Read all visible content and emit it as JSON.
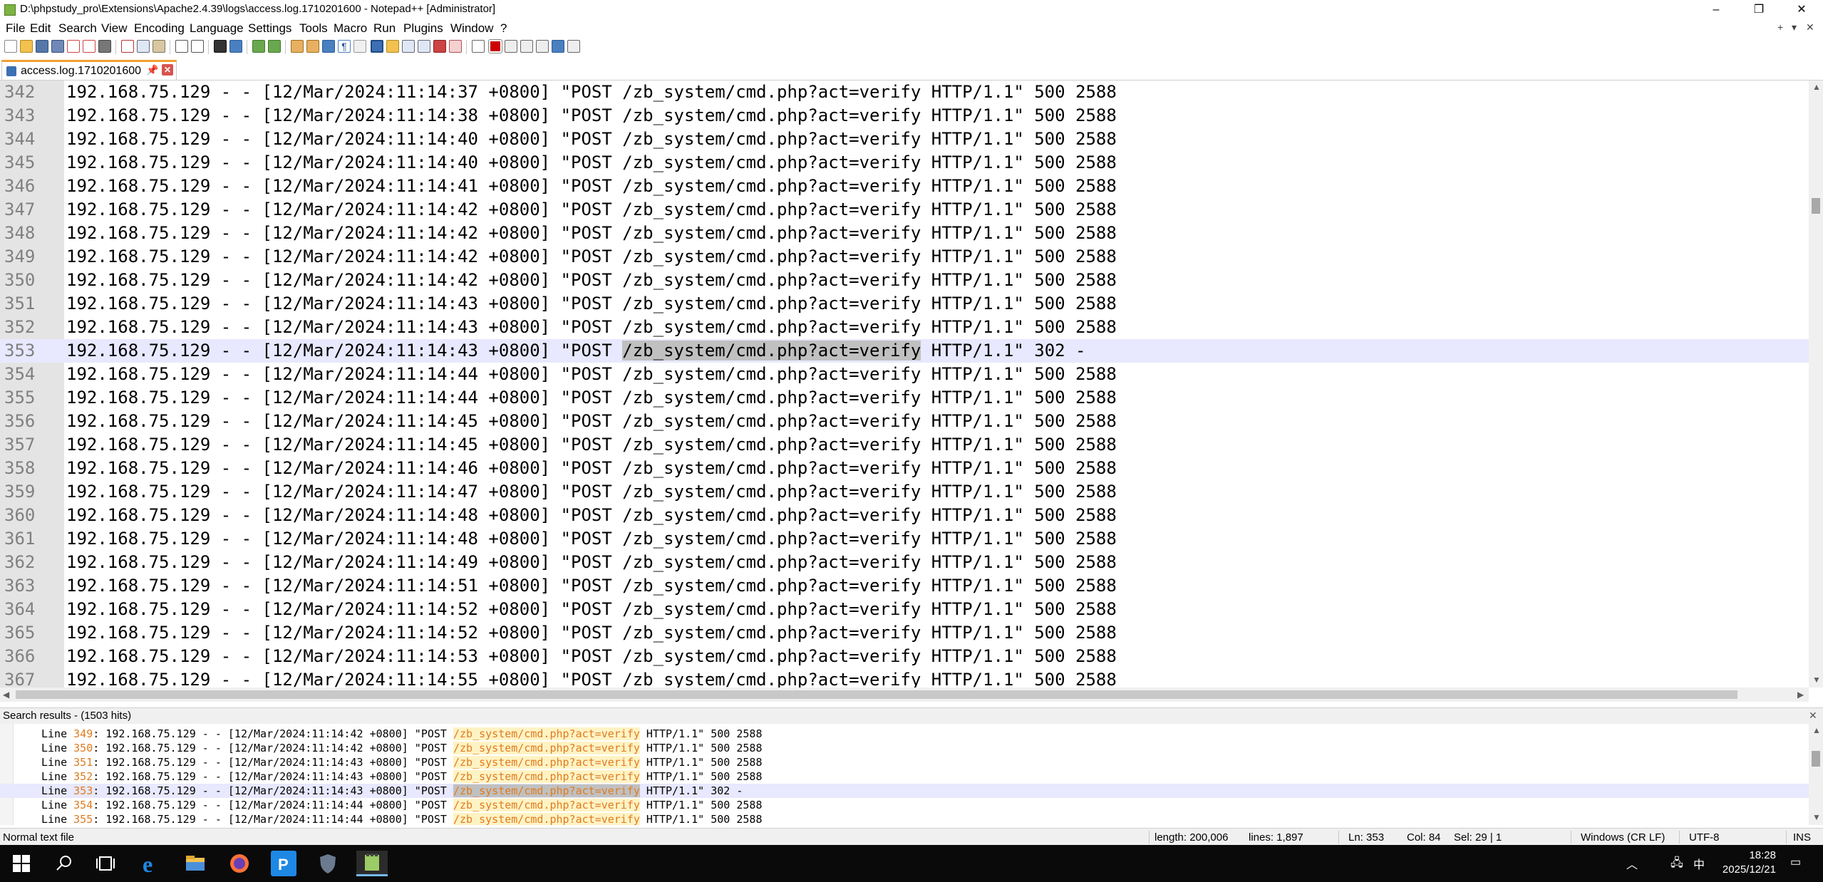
{
  "window": {
    "title": "D:\\phpstudy_pro\\Extensions\\Apache2.4.39\\logs\\access.log.1710201600 - Notepad++ [Administrator]",
    "controls": {
      "minimize": "–",
      "restore": "❐",
      "close": "✕"
    }
  },
  "menu": {
    "items": [
      "File",
      "Edit",
      "Search",
      "View",
      "Encoding",
      "Language",
      "Settings",
      "Tools",
      "Macro",
      "Run",
      "Plugins",
      "Window",
      "?"
    ],
    "right_controls": {
      "add": "+",
      "dropdown": "▾",
      "close": "✕"
    }
  },
  "tab": {
    "label": "access.log.1710201600",
    "pin": "📌",
    "close": "✕"
  },
  "editor": {
    "current_line": "353",
    "selection_text": "/zb_system/cmd.php?act=verify",
    "lines": [
      {
        "num": "342",
        "pre": "192.168.75.129 - - [12/Mar/2024:11:14:37 +0800] \"POST ",
        "sel": "",
        "post": "/zb_system/cmd.php?act=verify HTTP/1.1\" 500 2588"
      },
      {
        "num": "343",
        "pre": "192.168.75.129 - - [12/Mar/2024:11:14:38 +0800] \"POST ",
        "sel": "",
        "post": "/zb_system/cmd.php?act=verify HTTP/1.1\" 500 2588"
      },
      {
        "num": "344",
        "pre": "192.168.75.129 - - [12/Mar/2024:11:14:40 +0800] \"POST ",
        "sel": "",
        "post": "/zb_system/cmd.php?act=verify HTTP/1.1\" 500 2588"
      },
      {
        "num": "345",
        "pre": "192.168.75.129 - - [12/Mar/2024:11:14:40 +0800] \"POST ",
        "sel": "",
        "post": "/zb_system/cmd.php?act=verify HTTP/1.1\" 500 2588"
      },
      {
        "num": "346",
        "pre": "192.168.75.129 - - [12/Mar/2024:11:14:41 +0800] \"POST ",
        "sel": "",
        "post": "/zb_system/cmd.php?act=verify HTTP/1.1\" 500 2588"
      },
      {
        "num": "347",
        "pre": "192.168.75.129 - - [12/Mar/2024:11:14:42 +0800] \"POST ",
        "sel": "",
        "post": "/zb_system/cmd.php?act=verify HTTP/1.1\" 500 2588"
      },
      {
        "num": "348",
        "pre": "192.168.75.129 - - [12/Mar/2024:11:14:42 +0800] \"POST ",
        "sel": "",
        "post": "/zb_system/cmd.php?act=verify HTTP/1.1\" 500 2588"
      },
      {
        "num": "349",
        "pre": "192.168.75.129 - - [12/Mar/2024:11:14:42 +0800] \"POST ",
        "sel": "",
        "post": "/zb_system/cmd.php?act=verify HTTP/1.1\" 500 2588"
      },
      {
        "num": "350",
        "pre": "192.168.75.129 - - [12/Mar/2024:11:14:42 +0800] \"POST ",
        "sel": "",
        "post": "/zb_system/cmd.php?act=verify HTTP/1.1\" 500 2588"
      },
      {
        "num": "351",
        "pre": "192.168.75.129 - - [12/Mar/2024:11:14:43 +0800] \"POST ",
        "sel": "",
        "post": "/zb_system/cmd.php?act=verify HTTP/1.1\" 500 2588"
      },
      {
        "num": "352",
        "pre": "192.168.75.129 - - [12/Mar/2024:11:14:43 +0800] \"POST ",
        "sel": "",
        "post": "/zb_system/cmd.php?act=verify HTTP/1.1\" 500 2588"
      },
      {
        "num": "353",
        "pre": "192.168.75.129 - - [12/Mar/2024:11:14:43 +0800] \"POST ",
        "sel": "/zb_system/cmd.php?act=verify",
        "post": " HTTP/1.1\" 302 -"
      },
      {
        "num": "354",
        "pre": "192.168.75.129 - - [12/Mar/2024:11:14:44 +0800] \"POST ",
        "sel": "",
        "post": "/zb_system/cmd.php?act=verify HTTP/1.1\" 500 2588"
      },
      {
        "num": "355",
        "pre": "192.168.75.129 - - [12/Mar/2024:11:14:44 +0800] \"POST ",
        "sel": "",
        "post": "/zb_system/cmd.php?act=verify HTTP/1.1\" 500 2588"
      },
      {
        "num": "356",
        "pre": "192.168.75.129 - - [12/Mar/2024:11:14:45 +0800] \"POST ",
        "sel": "",
        "post": "/zb_system/cmd.php?act=verify HTTP/1.1\" 500 2588"
      },
      {
        "num": "357",
        "pre": "192.168.75.129 - - [12/Mar/2024:11:14:45 +0800] \"POST ",
        "sel": "",
        "post": "/zb_system/cmd.php?act=verify HTTP/1.1\" 500 2588"
      },
      {
        "num": "358",
        "pre": "192.168.75.129 - - [12/Mar/2024:11:14:46 +0800] \"POST ",
        "sel": "",
        "post": "/zb_system/cmd.php?act=verify HTTP/1.1\" 500 2588"
      },
      {
        "num": "359",
        "pre": "192.168.75.129 - - [12/Mar/2024:11:14:47 +0800] \"POST ",
        "sel": "",
        "post": "/zb_system/cmd.php?act=verify HTTP/1.1\" 500 2588"
      },
      {
        "num": "360",
        "pre": "192.168.75.129 - - [12/Mar/2024:11:14:48 +0800] \"POST ",
        "sel": "",
        "post": "/zb_system/cmd.php?act=verify HTTP/1.1\" 500 2588"
      },
      {
        "num": "361",
        "pre": "192.168.75.129 - - [12/Mar/2024:11:14:48 +0800] \"POST ",
        "sel": "",
        "post": "/zb_system/cmd.php?act=verify HTTP/1.1\" 500 2588"
      },
      {
        "num": "362",
        "pre": "192.168.75.129 - - [12/Mar/2024:11:14:49 +0800] \"POST ",
        "sel": "",
        "post": "/zb_system/cmd.php?act=verify HTTP/1.1\" 500 2588"
      },
      {
        "num": "363",
        "pre": "192.168.75.129 - - [12/Mar/2024:11:14:51 +0800] \"POST ",
        "sel": "",
        "post": "/zb_system/cmd.php?act=verify HTTP/1.1\" 500 2588"
      },
      {
        "num": "364",
        "pre": "192.168.75.129 - - [12/Mar/2024:11:14:52 +0800] \"POST ",
        "sel": "",
        "post": "/zb_system/cmd.php?act=verify HTTP/1.1\" 500 2588"
      },
      {
        "num": "365",
        "pre": "192.168.75.129 - - [12/Mar/2024:11:14:52 +0800] \"POST ",
        "sel": "",
        "post": "/zb_system/cmd.php?act=verify HTTP/1.1\" 500 2588"
      },
      {
        "num": "366",
        "pre": "192.168.75.129 - - [12/Mar/2024:11:14:53 +0800] \"POST ",
        "sel": "",
        "post": "/zb_system/cmd.php?act=verify HTTP/1.1\" 500 2588"
      },
      {
        "num": "367",
        "pre": "192.168.75.129 - - [12/Mar/2024:11:14:55 +0800] \"POST ",
        "sel": "",
        "post": "/zb_system/cmd.php?act=verify HTTP/1.1\" 500 2588"
      }
    ]
  },
  "search_results": {
    "title": "Search results - (1503 hits)",
    "close": "✕",
    "current_line": "353",
    "lines": [
      {
        "label": "Line ",
        "num": "349",
        "pre": ": 192.168.75.129 - - [12/Mar/2024:11:14:42 +0800] \"POST ",
        "match": "/zb_system/cmd.php?act=verify",
        "post": " HTTP/1.1\" 500 2588"
      },
      {
        "label": "Line ",
        "num": "350",
        "pre": ": 192.168.75.129 - - [12/Mar/2024:11:14:42 +0800] \"POST ",
        "match": "/zb_system/cmd.php?act=verify",
        "post": " HTTP/1.1\" 500 2588"
      },
      {
        "label": "Line ",
        "num": "351",
        "pre": ": 192.168.75.129 - - [12/Mar/2024:11:14:43 +0800] \"POST ",
        "match": "/zb_system/cmd.php?act=verify",
        "post": " HTTP/1.1\" 500 2588"
      },
      {
        "label": "Line ",
        "num": "352",
        "pre": ": 192.168.75.129 - - [12/Mar/2024:11:14:43 +0800] \"POST ",
        "match": "/zb_system/cmd.php?act=verify",
        "post": " HTTP/1.1\" 500 2588"
      },
      {
        "label": "Line ",
        "num": "353",
        "pre": ": 192.168.75.129 - - [12/Mar/2024:11:14:43 +0800] \"POST ",
        "match": "/zb_system/cmd.php?act=verify",
        "post": " HTTP/1.1\" 302 -"
      },
      {
        "label": "Line ",
        "num": "354",
        "pre": ": 192.168.75.129 - - [12/Mar/2024:11:14:44 +0800] \"POST ",
        "match": "/zb_system/cmd.php?act=verify",
        "post": " HTTP/1.1\" 500 2588"
      },
      {
        "label": "Line ",
        "num": "355",
        "pre": ": 192.168.75.129 - - [12/Mar/2024:11:14:44 +0800] \"POST ",
        "match": "/zb_system/cmd.php?act=verify",
        "post": " HTTP/1.1\" 500 2588"
      }
    ]
  },
  "status": {
    "file_type": "Normal text file",
    "length": "length: 200,006",
    "lines": "lines: 1,897",
    "ln": "Ln: 353",
    "col": "Col: 84",
    "sel": "Sel: 29 | 1",
    "eol": "Windows (CR LF)",
    "encoding": "UTF-8",
    "mode": "INS"
  },
  "taskbar": {
    "time": "18:28",
    "date": "2025/12/21",
    "ime": "中",
    "app_icons": [
      "windows-start-icon",
      "search-icon",
      "task-view-icon",
      "ie-icon",
      "file-explorer-icon",
      "firefox-icon",
      "phpstudy-icon",
      "shield-app-icon",
      "notepadpp-icon"
    ]
  },
  "colors": {
    "current_line_bg": "#e8e8ff",
    "selection_bg": "#c0c0c0",
    "gutter_bg": "#e4e4e4",
    "search_match": "#e07b1f",
    "taskbar_bg": "#0a0a0a",
    "tab_accent": "#f0a030"
  }
}
